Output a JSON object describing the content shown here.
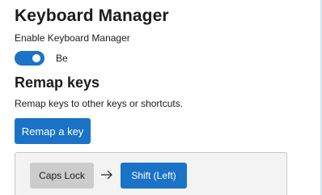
{
  "header": {
    "title": "Keyboard Manager"
  },
  "enable": {
    "label": "Enable Keyboard Manager",
    "toggle_on": true,
    "toggle_state_text": "Be"
  },
  "remap_keys": {
    "title": "Remap keys",
    "description": "Remap keys to other keys or shortcuts.",
    "button_label": "Remap a key",
    "mappings": [
      {
        "from": "Caps Lock",
        "to": "Shift (Left)",
        "arrow_icon": "arrow-right-icon"
      }
    ]
  },
  "colors": {
    "accent": "#1a73c7",
    "panel_bg": "#f3f3f3",
    "source_key_bg": "#cccccc"
  }
}
